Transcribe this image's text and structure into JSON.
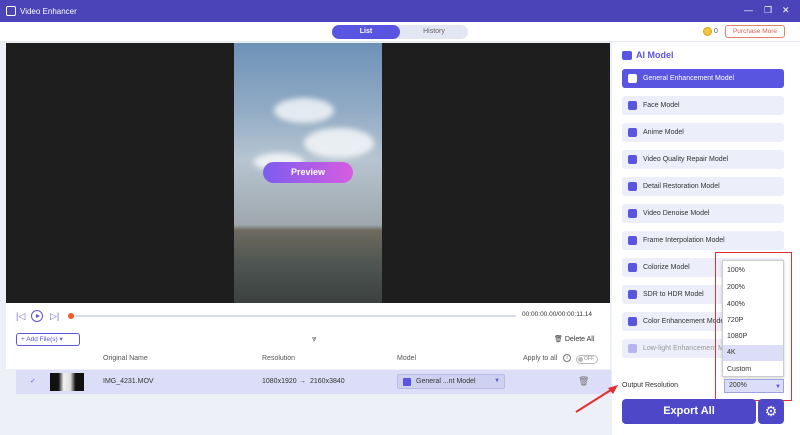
{
  "window": {
    "title": "Video Enhancer"
  },
  "tabs": [
    {
      "label": "List"
    },
    {
      "label": "History"
    }
  ],
  "header": {
    "credits": "0",
    "purchase_label": "Purchase More"
  },
  "preview": {
    "button_label": "Preview"
  },
  "player": {
    "timecode": "00:00:00.00/00:00:11.14",
    "progress": 0.0
  },
  "toolbar": {
    "add_files_label": "Add File(s)",
    "delete_all_label": "Delete All"
  },
  "table": {
    "headers": {
      "original_name": "Original Name",
      "resolution": "Resolution",
      "model": "Model",
      "apply_to_all": "Apply to all",
      "toggle_state": "OFF"
    },
    "rows": [
      {
        "name": "IMG_4231.MOV",
        "res_from": "1080x1920",
        "res_to": "2160x3840",
        "model": "General ...nt Model"
      }
    ]
  },
  "panel": {
    "heading": "AI Model",
    "models": [
      {
        "label": "General Enhancement Model"
      },
      {
        "label": "Face Model"
      },
      {
        "label": "Anime Model"
      },
      {
        "label": "Video Quality Repair Model"
      },
      {
        "label": "Detail Restoration Model"
      },
      {
        "label": "Video Denoise Model"
      },
      {
        "label": "Frame Interpolation Model"
      },
      {
        "label": "Colorize Model"
      },
      {
        "label": "SDR to HDR Model"
      },
      {
        "label": "Color Enhancement Mode"
      },
      {
        "label": "Low-light Enhancement M"
      }
    ],
    "output_resolution_label": "Output Resolution",
    "output_resolution_value": "200%",
    "resolution_options": [
      "100%",
      "200%",
      "400%",
      "720P",
      "1080P",
      "4K",
      "Custom"
    ],
    "export_label": "Export All"
  },
  "colors": {
    "accent": "#5a55e0",
    "titlebar": "#4a44b8",
    "highlight_box": "#e03030"
  }
}
